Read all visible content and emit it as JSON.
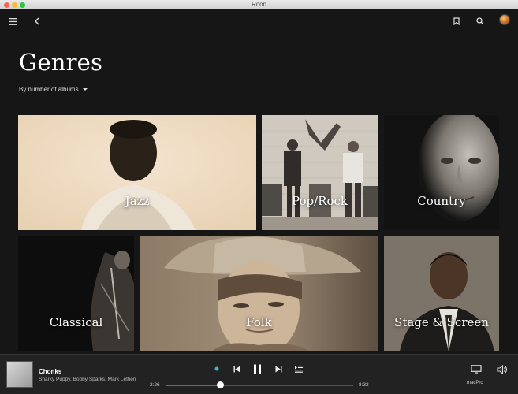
{
  "window": {
    "title": "Roon"
  },
  "page": {
    "title": "Genres",
    "sort_label": "By number of albums"
  },
  "genres": [
    {
      "label": "Jazz"
    },
    {
      "label": "Pop/Rock"
    },
    {
      "label": "Country"
    },
    {
      "label": "Classical"
    },
    {
      "label": "Folk"
    },
    {
      "label": "Stage & Screen"
    }
  ],
  "now_playing": {
    "title": "Chonks",
    "artist": "Snarky Puppy, Bobby Sparks, Mark Lettieri",
    "elapsed": "2:26",
    "duration": "8:32",
    "progress": 0.29
  },
  "zone": {
    "name": "macPro"
  },
  "icons": {
    "menu": "hamburger-icon",
    "back": "back-arrow-icon",
    "bookmark": "bookmark-icon",
    "search": "search-icon",
    "radio": "radio-indicator-icon",
    "prev": "previous-track-icon",
    "pause": "pause-icon",
    "next": "next-track-icon",
    "queue": "queue-icon",
    "zone": "display-zone-icon",
    "volume": "volume-icon"
  },
  "colors": {
    "accent": "#e2364b",
    "background": "#161616",
    "bar": "#222222"
  }
}
